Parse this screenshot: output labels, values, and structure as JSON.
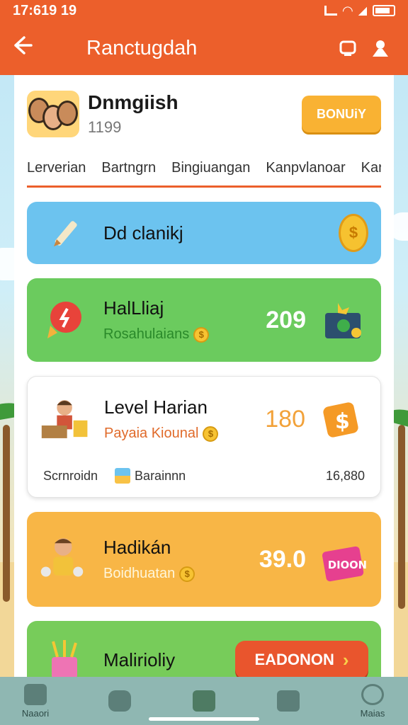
{
  "status_bar": {
    "time": "17:619 19"
  },
  "app_bar": {
    "title": "Ranctugdah",
    "back_icon": "arrow-left-icon",
    "actions": [
      "device-icon",
      "person-icon"
    ]
  },
  "profile": {
    "name": "Dnmgiish",
    "count": "1199",
    "bonus_label": "BONUiY"
  },
  "tabs": [
    "Lerverian",
    "Bartngrn",
    "Bingiuangan",
    "Kanpvlanoar",
    "Kar"
  ],
  "cards": {
    "blue": {
      "title": "Dd clanikj",
      "icon": "pencil-icon",
      "trailing_icon": "coin-icon",
      "coin_glyph": "$"
    },
    "green": {
      "title": "HalLliaj",
      "subtitle": "Rosahulaians",
      "value": "209",
      "icon": "rocket-icon",
      "trailing_icon": "treasure-box-icon"
    },
    "white": {
      "title": "Level Harian",
      "subtitle": "Payaia Kiounal",
      "value": "180",
      "left_label": "Scrnroidn",
      "mid_label": "Barainnn",
      "right_value": "16,880",
      "icon": "person-with-gold-icon",
      "trailing_icon": "money-bag-icon"
    },
    "yellow": {
      "title": "Hadikán",
      "subtitle": "Boidhuatan",
      "value": "39.0",
      "icon": "person-with-coins-icon",
      "trailing_icon": "tag-icon",
      "tag_text": "DIOON"
    },
    "lime": {
      "title": "Malirioliy",
      "button_label": "EADONON",
      "icon": "cup-icon"
    }
  },
  "bottom_nav": [
    {
      "label": "Naaori",
      "icon": "home-icon"
    },
    {
      "label": "",
      "icon": "square-icon"
    },
    {
      "label": "",
      "icon": "house-icon"
    },
    {
      "label": "",
      "icon": "tag-icon"
    },
    {
      "label": "Maias",
      "icon": "chat-icon"
    }
  ],
  "colors": {
    "primary": "#ec5f2b",
    "bonus": "#f9b233",
    "blue_card": "#6cc3ef",
    "green_card": "#6bcb5e",
    "yellow_card": "#f8b646"
  }
}
